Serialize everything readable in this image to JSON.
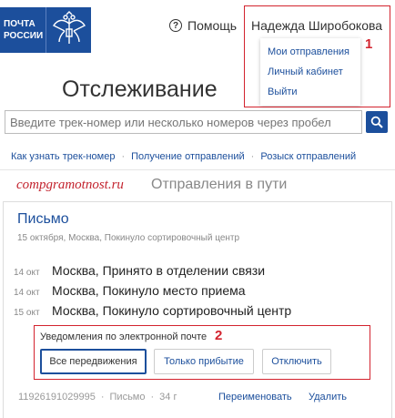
{
  "header": {
    "logo_line1": "ПОЧТА",
    "logo_line2": "РОССИИ",
    "help_label": "Помощь",
    "user_name": "Надежда Широбокова",
    "brand_color": "#1c4f9c"
  },
  "user_menu": {
    "items": [
      "Мои отправления",
      "Личный кабинет",
      "Выйти"
    ]
  },
  "annotations": {
    "marker1": "1",
    "marker2": "2",
    "marker_color": "#d3232e"
  },
  "page": {
    "title": "Отслеживание"
  },
  "search": {
    "placeholder": "Введите трек-номер или несколько номеров через пробел",
    "button_icon": "search-icon"
  },
  "links": [
    "Как узнать трек-номер",
    "Получение отправлений",
    "Розыск отправлений"
  ],
  "watermark": "compgramotnost.ru",
  "section_title": "Отправления в пути",
  "shipment": {
    "title": "Письмо",
    "subtitle": "15 октября, Москва, Покинуло сортировочный центр",
    "events": [
      {
        "date": "14 окт",
        "text": "Москва, Принято в отделении связи"
      },
      {
        "date": "14 окт",
        "text": "Москва, Покинуло место приема"
      },
      {
        "date": "15 окт",
        "text": "Москва, Покинуло сортировочный центр"
      }
    ],
    "notifications_label": "Уведомления по электронной почте",
    "notify_buttons": [
      "Все передвижения",
      "Только прибытие",
      "Отключить"
    ],
    "track_number": "11926191029995",
    "type": "Письмо",
    "weight": "34 г",
    "rename_label": "Переименовать",
    "delete_label": "Удалить"
  }
}
